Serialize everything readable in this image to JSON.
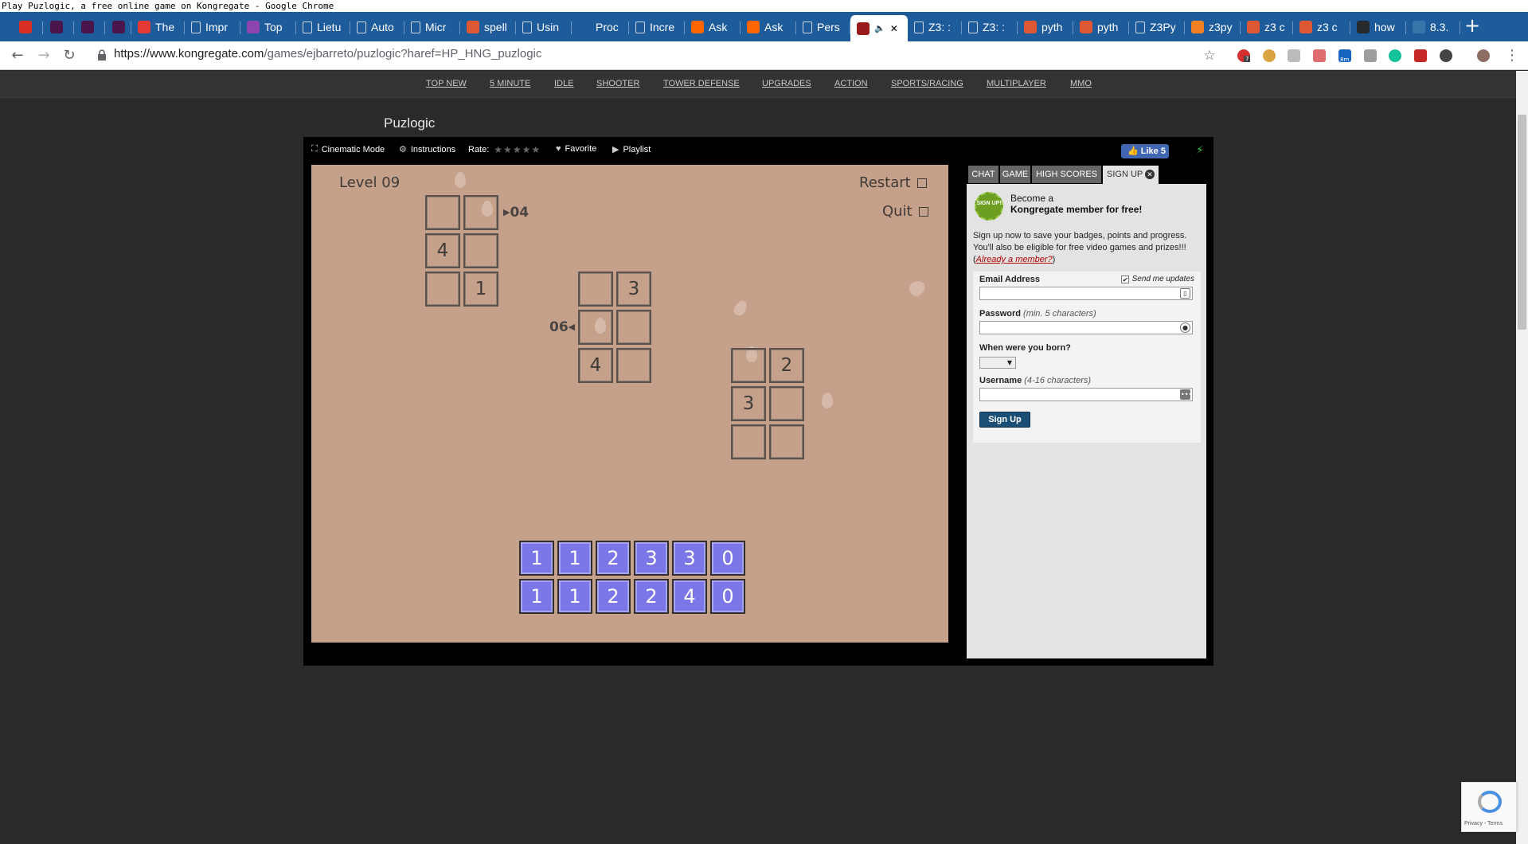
{
  "window": {
    "title": "Play Puzlogic, a free online game on Kongregate - Google Chrome"
  },
  "tabs": [
    {
      "label": "",
      "icon": "gmail-icon",
      "color": "#d93025"
    },
    {
      "label": "",
      "icon": "slack-icon",
      "color": "#4a154b"
    },
    {
      "label": "",
      "icon": "slack-icon",
      "color": "#4a154b"
    },
    {
      "label": "",
      "icon": "slack-icon",
      "color": "#4a154b"
    },
    {
      "label": "The",
      "icon": "red-icon",
      "color": "#e53935"
    },
    {
      "label": "Impr",
      "icon": "page-icon",
      "color": ""
    },
    {
      "label": "Top",
      "icon": "seven-icon",
      "color": "#8e44ad"
    },
    {
      "label": "Lietu",
      "icon": "page-icon",
      "color": ""
    },
    {
      "label": "Auto",
      "icon": "page-icon",
      "color": ""
    },
    {
      "label": "Micr",
      "icon": "page-icon",
      "color": ""
    },
    {
      "label": "spell",
      "icon": "duckduckgo-icon",
      "color": "#de5833"
    },
    {
      "label": "Usin",
      "icon": "page-icon",
      "color": ""
    },
    {
      "label": "Proc",
      "icon": "stackexchange-icon",
      "color": "#1e5b9b"
    },
    {
      "label": "Incre",
      "icon": "page-icon",
      "color": ""
    },
    {
      "label": "Ask",
      "icon": "ycombinator-icon",
      "color": "#ff6600"
    },
    {
      "label": "Ask",
      "icon": "ycombinator-icon",
      "color": "#ff6600"
    },
    {
      "label": "Pers",
      "icon": "page-icon",
      "color": ""
    },
    {
      "label": "",
      "icon": "kongregate-icon",
      "color": "#9a1b1b"
    },
    {
      "label": "Z3: :",
      "icon": "page-icon",
      "color": ""
    },
    {
      "label": "Z3: :",
      "icon": "page-icon",
      "color": ""
    },
    {
      "label": "pyth",
      "icon": "duckduckgo-icon",
      "color": "#de5833"
    },
    {
      "label": "pyth",
      "icon": "duckduckgo-icon",
      "color": "#de5833"
    },
    {
      "label": "Z3Py",
      "icon": "page-icon",
      "color": ""
    },
    {
      "label": "z3py",
      "icon": "stackoverflow-icon",
      "color": "#f48024"
    },
    {
      "label": "z3 c",
      "icon": "duckduckgo-icon",
      "color": "#de5833"
    },
    {
      "label": "z3 c",
      "icon": "duckduckgo-icon",
      "color": "#de5833"
    },
    {
      "label": "how",
      "icon": "github-icon",
      "color": "#24292e"
    },
    {
      "label": "8.3.",
      "icon": "python-icon",
      "color": "#3776ab"
    }
  ],
  "addressbar": {
    "host": "https://www.kongregate.com",
    "path": "/games/ejbarreto/puzlogic?haref=HP_HNG_puzlogic"
  },
  "extensions": {
    "badge1": "7",
    "badge2": "8m"
  },
  "categories": [
    "TOP NEW",
    "5 MINUTE",
    "IDLE",
    "SHOOTER",
    "TOWER DEFENSE",
    "UPGRADES",
    "ACTION",
    "SPORTS/RACING",
    "MULTIPLAYER",
    "MMO"
  ],
  "game": {
    "title": "Puzlogic",
    "toolbar": {
      "cinematic": "Cinematic Mode",
      "instructions": "Instructions",
      "rate": "Rate:",
      "stars": "★★★★★",
      "favorite": "Favorite",
      "playlist": "Playlist",
      "like": "Like 5"
    },
    "level": "Level 09",
    "restart": "Restart",
    "quit": "Quit",
    "grids": [
      {
        "clue": "04",
        "clue_row": 0,
        "clue_side": "right",
        "cells": [
          [
            "",
            ""
          ],
          [
            "4",
            ""
          ],
          [
            "",
            "1"
          ]
        ]
      },
      {
        "clue": "06",
        "clue_row": 1,
        "clue_side": "left",
        "cells": [
          [
            "",
            "3"
          ],
          [
            "",
            ""
          ],
          [
            "4",
            ""
          ]
        ]
      },
      {
        "clue": "",
        "cells": [
          [
            "",
            "2"
          ],
          [
            "3",
            ""
          ],
          [
            "",
            ""
          ]
        ]
      }
    ],
    "pieces_row1": [
      "1",
      "1",
      "2",
      "3",
      "3",
      "0"
    ],
    "pieces_row2": [
      "1",
      "1",
      "2",
      "2",
      "4",
      "0"
    ],
    "colors": {
      "canvas": "#c5a08a",
      "piece": "#7b77e8"
    }
  },
  "panel": {
    "tabs": [
      "CHAT",
      "GAME",
      "HIGH SCORES",
      "SIGN UP"
    ],
    "badge": "SIGN UP!",
    "become_line1": "Become a",
    "become_line2": "Kongregate member for free!",
    "desc1": "Sign up now to save your badges, points and progress.",
    "desc2": "You'll also be eligible for free video games and prizes!!!",
    "already_open": "(",
    "already": "Already a member?",
    "already_close": ")",
    "email_label": "Email Address",
    "send_updates": "Send me updates",
    "password_label": "Password",
    "password_hint": "(min. 5 characters)",
    "born_label": "When were you born?",
    "username_label": "Username",
    "username_hint": "(4-16 characters)",
    "signup_button": "Sign Up"
  },
  "recaptcha": {
    "text": "Privacy - Terms"
  }
}
